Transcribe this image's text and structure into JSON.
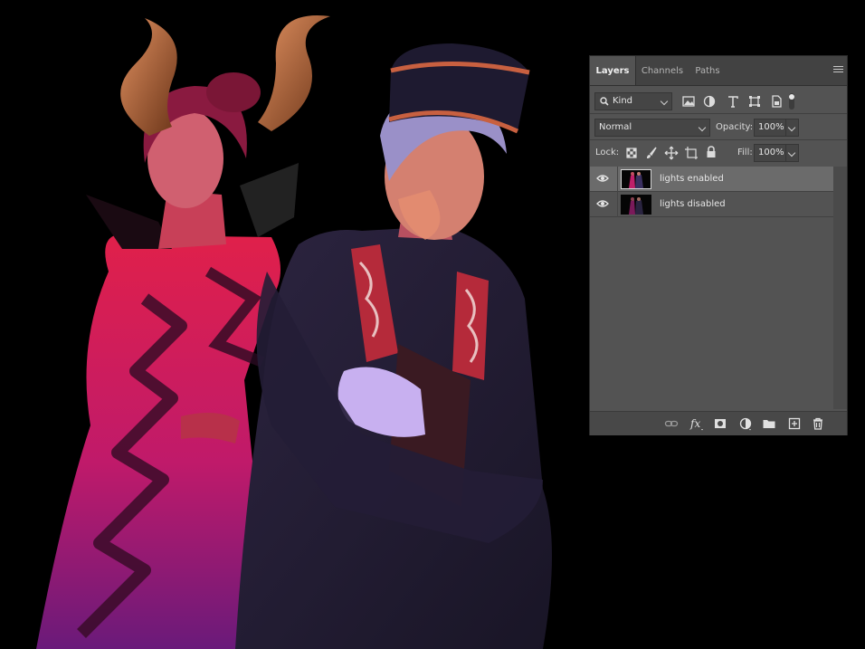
{
  "layers_panel": {
    "tabs": [
      {
        "label": "Layers",
        "active": true
      },
      {
        "label": "Channels",
        "active": false
      },
      {
        "label": "Paths",
        "active": false
      }
    ],
    "filter": {
      "kind_label": "Kind"
    },
    "blend": {
      "mode": "Normal",
      "opacity_label": "Opacity:",
      "opacity_value": "100%"
    },
    "lock": {
      "label": "Lock:",
      "fill_label": "Fill:",
      "fill_value": "100%"
    },
    "layers": [
      {
        "name": "lights enabled",
        "visible": true,
        "selected": true
      },
      {
        "name": "lights disabled",
        "visible": true,
        "selected": false
      }
    ]
  },
  "colors": {
    "panel_bg": "#535353",
    "selected_row": "#6b6b6b",
    "canvas_bg": "#000000"
  },
  "icons": [
    "search-icon",
    "image-filter-icon",
    "adjustment-filter-icon",
    "type-filter-icon",
    "shape-filter-icon",
    "smart-object-filter-icon",
    "filter-toggle-icon",
    "lock-transparent-icon",
    "lock-paint-icon",
    "lock-position-icon",
    "lock-artboard-icon",
    "lock-all-icon",
    "eye-icon",
    "link-layers-icon",
    "fx-icon",
    "add-mask-icon",
    "adjustment-layer-icon",
    "new-group-icon",
    "new-layer-icon",
    "delete-layer-icon",
    "panel-menu-icon"
  ]
}
